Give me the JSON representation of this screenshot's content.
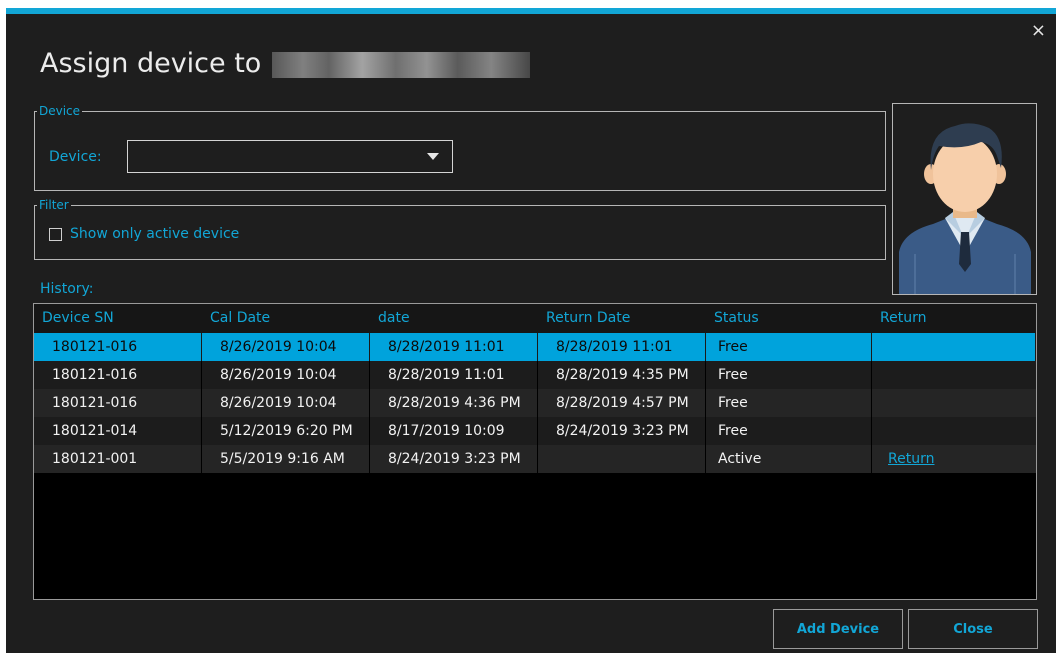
{
  "window": {
    "title": "Assign device to",
    "close_glyph": "×",
    "accent_color": "#12a6d6",
    "background_color": "#1e1e1e"
  },
  "device_group": {
    "legend": "Device",
    "device_label": "Device:",
    "device_value": ""
  },
  "filter_group": {
    "legend": "Filter",
    "show_active_label": "Show only active device",
    "show_active_checked": false
  },
  "avatar": {
    "icon": "user-avatar-icon"
  },
  "history": {
    "label": "History:",
    "columns": [
      "Device SN",
      "Cal Date",
      "date",
      "Return Date",
      "Status",
      "Return"
    ],
    "rows": [
      {
        "sn": "180121-016",
        "cal": "8/26/2019 10:04",
        "date": "8/28/2019 11:01",
        "ret": "8/28/2019 11:01",
        "status": "Free",
        "action": ""
      },
      {
        "sn": "180121-016",
        "cal": "8/26/2019 10:04",
        "date": "8/28/2019 11:01",
        "ret": "8/28/2019 4:35 PM",
        "status": "Free",
        "action": ""
      },
      {
        "sn": "180121-016",
        "cal": "8/26/2019 10:04",
        "date": "8/28/2019 4:36 PM",
        "ret": "8/28/2019 4:57 PM",
        "status": "Free",
        "action": ""
      },
      {
        "sn": "180121-014",
        "cal": "5/12/2019 6:20 PM",
        "date": "8/17/2019 10:09",
        "ret": "8/24/2019 3:23 PM",
        "status": "Free",
        "action": ""
      },
      {
        "sn": "180121-001",
        "cal": "5/5/2019 9:16 AM",
        "date": "8/24/2019 3:23 PM",
        "ret": "",
        "status": "Active",
        "action": "Return"
      }
    ],
    "selected_row": 0
  },
  "buttons": {
    "add_device": "Add Device",
    "close": "Close"
  }
}
